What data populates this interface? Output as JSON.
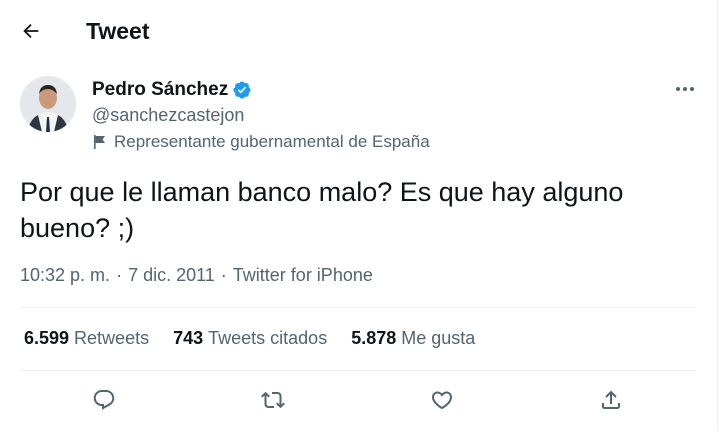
{
  "header": {
    "title": "Tweet"
  },
  "author": {
    "name": "Pedro Sánchez",
    "handle": "@sanchezcastejon",
    "label": "Representante gubernamental de España"
  },
  "tweet": {
    "text": "Por que le llaman banco malo? Es que hay alguno bueno? ;)",
    "time": "10:32 p. m.",
    "date": "7 dic. 2011",
    "source": "Twitter for iPhone",
    "separator": "·"
  },
  "stats": [
    {
      "count": "6.599",
      "label": "Retweets"
    },
    {
      "count": "743",
      "label": "Tweets citados"
    },
    {
      "count": "5.878",
      "label": "Me gusta"
    }
  ],
  "icons": {
    "back": "arrow-left-icon",
    "verified": "verified-badge-icon",
    "more": "more-options-icon",
    "label": "flag-icon",
    "reply": "reply-icon",
    "retweet": "retweet-icon",
    "like": "heart-icon",
    "share": "share-icon"
  },
  "colors": {
    "verified": "#1d9bf0",
    "secondary_text": "#536471",
    "primary_text": "#0f1419"
  }
}
